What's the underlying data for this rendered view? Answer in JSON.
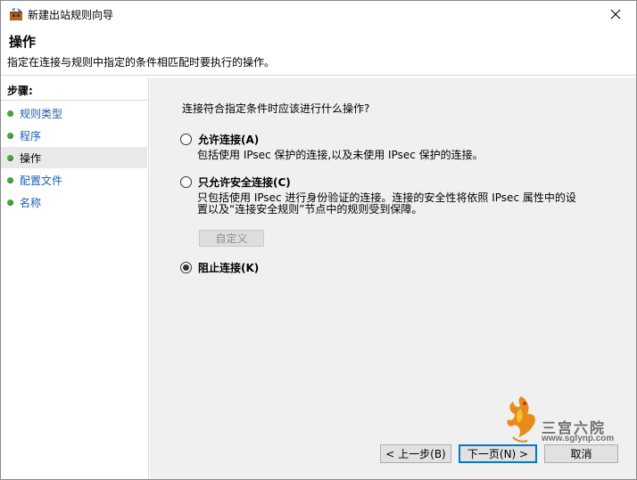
{
  "window": {
    "title": "新建出站规则向导"
  },
  "header": {
    "title": "操作",
    "description": "指定在连接与规则中指定的条件相匹配时要执行的操作。"
  },
  "steps": {
    "label": "步骤:",
    "items": [
      {
        "label": "规则类型",
        "current": false
      },
      {
        "label": "程序",
        "current": false
      },
      {
        "label": "操作",
        "current": true
      },
      {
        "label": "配置文件",
        "current": false
      },
      {
        "label": "名称",
        "current": false
      }
    ]
  },
  "main": {
    "question": "连接符合指定条件时应该进行什么操作?",
    "options": [
      {
        "label": "允许连接(A)",
        "description": "包括使用 IPsec 保护的连接,以及未使用 IPsec 保护的连接。",
        "checked": false
      },
      {
        "label": "只允许安全连接(C)",
        "description_line1": "只包括使用 IPsec 进行身份验证的连接。连接的安全性将依照 IPsec 属性中的设",
        "description_line2": "置以及“连接安全规则”节点中的规则受到保障。",
        "checked": false
      },
      {
        "label": "阻止连接(K)",
        "checked": true
      }
    ],
    "custom_button": "自定义"
  },
  "buttons": {
    "back": "< 上一步(B)",
    "next": "下一页(N) >",
    "cancel": "取消"
  },
  "watermark": {
    "text": "三宫六院",
    "url": "www.sglynp.com"
  },
  "colors": {
    "step_dot": "#4aa83b",
    "step_link": "#1a5fb4",
    "pane_bg": "#f0f0f0",
    "accent": "#0078d7"
  },
  "icons": {
    "app": "firewall-wizard-icon",
    "close": "close-icon",
    "watermark": "phoenix-logo"
  }
}
